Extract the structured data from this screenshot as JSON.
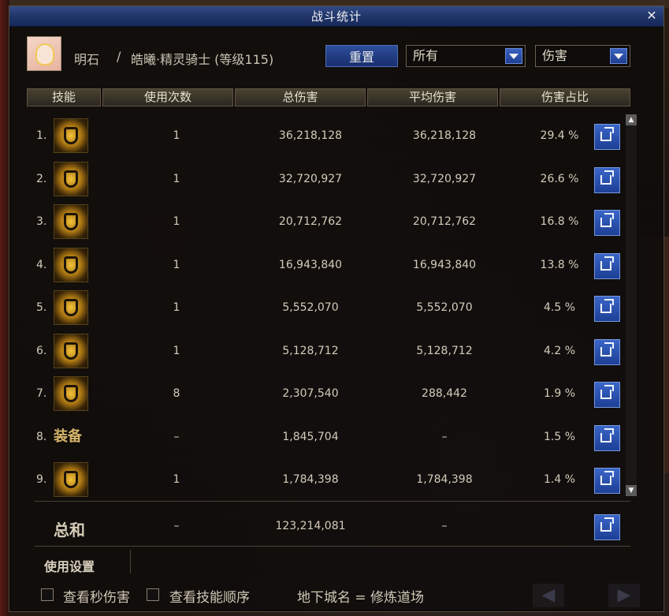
{
  "window": {
    "title": "战斗统计",
    "close_glyph": "✕"
  },
  "character": {
    "name": "明石",
    "separator": "/",
    "class_level": "皓曦·精灵骑士 (等级115)"
  },
  "toolbar": {
    "reset_label": "重置",
    "type_select": "所有",
    "metric_select": "伤害"
  },
  "table": {
    "headers": [
      "技能",
      "使用次数",
      "总伤害",
      "平均伤害",
      "伤害占比"
    ],
    "rows": [
      {
        "num": "1.",
        "icon": "skill-icon-1",
        "uses": "1",
        "total": "36,218,128",
        "avg": "36,218,128",
        "pct": "29.4 %"
      },
      {
        "num": "2.",
        "icon": "skill-icon-2",
        "uses": "1",
        "total": "32,720,927",
        "avg": "32,720,927",
        "pct": "26.6 %"
      },
      {
        "num": "3.",
        "icon": "skill-icon-3",
        "uses": "1",
        "total": "20,712,762",
        "avg": "20,712,762",
        "pct": "16.8 %"
      },
      {
        "num": "4.",
        "icon": "skill-icon-4",
        "uses": "1",
        "total": "16,943,840",
        "avg": "16,943,840",
        "pct": "13.8 %"
      },
      {
        "num": "5.",
        "icon": "skill-icon-5",
        "uses": "1",
        "total": "5,552,070",
        "avg": "5,552,070",
        "pct": "4.5 %"
      },
      {
        "num": "6.",
        "icon": "skill-icon-6",
        "uses": "1",
        "total": "5,128,712",
        "avg": "5,128,712",
        "pct": "4.2 %"
      },
      {
        "num": "7.",
        "icon": "skill-icon-7",
        "uses": "8",
        "total": "2,307,540",
        "avg": "288,442",
        "pct": "1.9 %"
      },
      {
        "num": "8.",
        "icon": "equipment-label",
        "label": "装备",
        "uses": "–",
        "total": "1,845,704",
        "avg": "–",
        "pct": "1.5 %"
      },
      {
        "num": "9.",
        "icon": "skill-icon-9",
        "uses": "1",
        "total": "1,784,398",
        "avg": "1,784,398",
        "pct": "1.4 %"
      }
    ],
    "total": {
      "label": "总和",
      "uses": "–",
      "total": "123,214,081",
      "avg": "–"
    }
  },
  "footer": {
    "settings_label": "使用设置",
    "per_second_label": "查看秒伤害",
    "skill_order_label": "查看技能顺序",
    "dungeon_label": "地下城名 = 修炼道场"
  },
  "colors": {
    "titlebar": "#1f3468",
    "button_blue": "#2f4e9c",
    "text": "#d4ccba",
    "equip_gold": "#d6b56a"
  }
}
